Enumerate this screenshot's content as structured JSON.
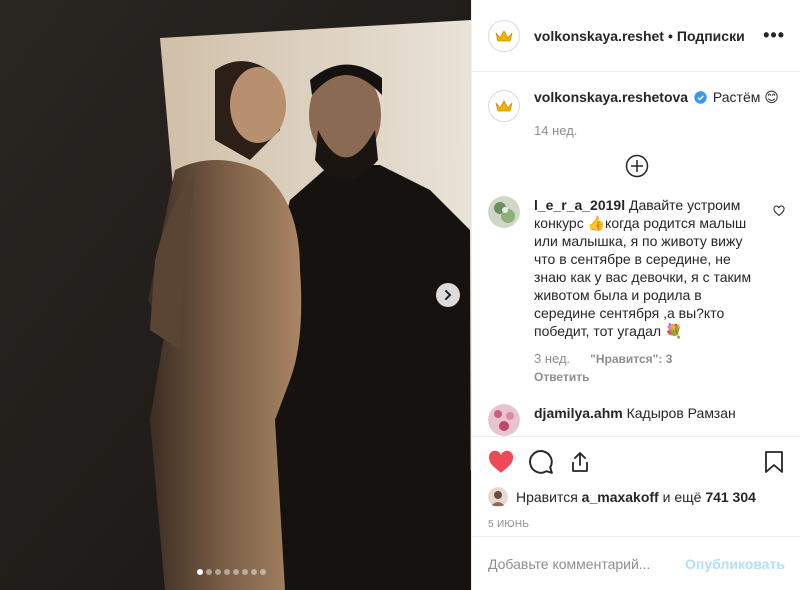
{
  "post": {
    "image_dots": 8,
    "active_dot": 0
  },
  "header": {
    "username": "volkonskaya.reshetova",
    "separator": "•",
    "follow_label": "Подписки",
    "more_label": "•••"
  },
  "caption": {
    "username": "volkonskaya.reshetova",
    "verified_icon": "verified-badge-icon",
    "text": "Растём 😊",
    "time": "14 нед."
  },
  "comments": [
    {
      "username": "l_e_r_a_2019l",
      "text": "Давайте устроим конкурс 👍когда родится малыш или малышка, я по животу вижу что в сентябре в середине, не знаю как у вас девочки, я с таким животом была и родила в середине сентября ,а вы?кто победит, тот угадал 💐",
      "time": "3 нед.",
      "likes": "\"Нравится\": 3",
      "reply_label": "Ответить"
    },
    {
      "username": "djamilya.ahm",
      "text": "Кадыров Рамзан"
    }
  ],
  "likes": {
    "prefix": "Нравится",
    "user": "a_maxakoff",
    "middle": "и ещё",
    "count": "741 304"
  },
  "date": "5 июнь",
  "add_comment": {
    "placeholder": "Добавьте комментарий...",
    "publish_label": "Опубликовать"
  },
  "colors": {
    "liked_heart": "#ed4956",
    "verified": "#3897f0",
    "publish_disabled": "#b2dffc",
    "crown": "#f0b400"
  }
}
